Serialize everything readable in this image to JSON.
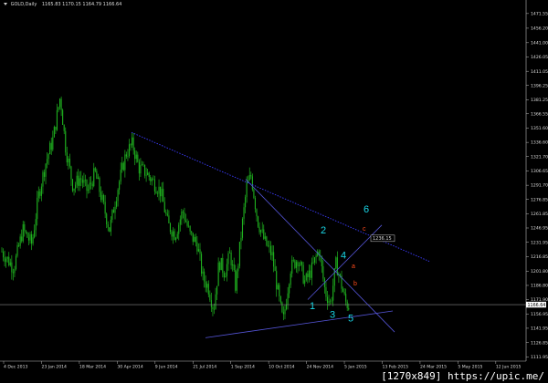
{
  "header": {
    "symbol": "GOLD,Daily",
    "ohlc": "1165.83 1170.15 1164.79 1166.64"
  },
  "watermark": "[1270x849] https://upic.me/",
  "colors": {
    "background": "#000000",
    "candles": "#1fb01f",
    "wave_labels": "#19d6e6",
    "sub_wave_labels": "#ff4a1a",
    "trendline_main": "#5555d8",
    "trendline_dotted": "#3c3cff",
    "price_marker": "#ffffff"
  },
  "chart_data": {
    "type": "candlestick",
    "title": "",
    "xlabel": "",
    "ylabel": "",
    "grid": false,
    "ylim": [
      1107.5,
      1480.0
    ],
    "y_ticks": [
      "1471.55",
      "1456.20",
      "1441.00",
      "1426.05",
      "1411.05",
      "1396.25",
      "1381.25",
      "1366.55",
      "1351.60",
      "1336.60",
      "1321.70",
      "1306.65",
      "1291.70",
      "1276.85",
      "1261.85",
      "1246.95",
      "1231.95",
      "1216.85",
      "1201.80",
      "1186.80",
      "1171.90",
      "1156.95",
      "1141.95",
      "1126.85",
      "1111.95"
    ],
    "x_ticks": [
      "4 Dec 2013",
      "23 Jan 2014",
      "18 Mar 2014",
      "30 Apr 2014",
      "9 Jun 2014",
      "21 Jul 2014",
      "1 Sep 2014",
      "10 Oct 2014",
      "24 Nov 2014",
      "5 Jan 2015",
      "13 Feb 2015",
      "24 Mar 2015",
      "5 May 2015",
      "12 Jun 2015"
    ],
    "current_price": "1166.64",
    "price_box": "1236.15",
    "price_path": [
      [
        0,
        1225
      ],
      [
        15,
        1205
      ],
      [
        25,
        1245
      ],
      [
        35,
        1230
      ],
      [
        42,
        1280
      ],
      [
        50,
        1315
      ],
      [
        58,
        1340
      ],
      [
        66,
        1385
      ],
      [
        72,
        1330
      ],
      [
        80,
        1290
      ],
      [
        88,
        1300
      ],
      [
        96,
        1285
      ],
      [
        104,
        1305
      ],
      [
        112,
        1275
      ],
      [
        120,
        1245
      ],
      [
        128,
        1285
      ],
      [
        138,
        1325
      ],
      [
        145,
        1335
      ],
      [
        152,
        1310
      ],
      [
        160,
        1305
      ],
      [
        168,
        1295
      ],
      [
        176,
        1285
      ],
      [
        184,
        1250
      ],
      [
        192,
        1240
      ],
      [
        200,
        1265
      ],
      [
        208,
        1240
      ],
      [
        216,
        1230
      ],
      [
        222,
        1195
      ],
      [
        228,
        1185
      ],
      [
        234,
        1162
      ],
      [
        240,
        1212
      ],
      [
        246,
        1200
      ],
      [
        252,
        1220
      ],
      [
        258,
        1185
      ],
      [
        264,
        1240
      ],
      [
        270,
        1290
      ],
      [
        275,
        1302
      ],
      [
        282,
        1255
      ],
      [
        290,
        1232
      ],
      [
        298,
        1218
      ],
      [
        305,
        1175
      ],
      [
        310,
        1148
      ],
      [
        318,
        1205
      ],
      [
        326,
        1215
      ],
      [
        334,
        1190
      ],
      [
        342,
        1205
      ],
      [
        349,
        1225
      ],
      [
        356,
        1180
      ],
      [
        362,
        1168
      ],
      [
        368,
        1210
      ],
      [
        372,
        1195
      ],
      [
        378,
        1170
      ],
      [
        382,
        1165
      ]
    ],
    "trendlines": [
      {
        "kind": "solid",
        "p1": [
          269,
          1298
        ],
        "p2": [
          432,
          1138
        ]
      },
      {
        "kind": "solid",
        "p1": [
          225,
          1132
        ],
        "p2": [
          430,
          1160
        ]
      },
      {
        "kind": "dotted",
        "p1": [
          144,
          1347
        ],
        "p2": [
          470,
          1212
        ]
      },
      {
        "kind": "solid",
        "p1": [
          337,
          1172
        ],
        "p2": [
          418,
          1250
        ]
      }
    ],
    "annotations": [
      {
        "text": "1",
        "x": 339,
        "y": 1162,
        "class": "wave"
      },
      {
        "text": "2",
        "x": 351,
        "y": 1241,
        "class": "wave"
      },
      {
        "text": "3",
        "x": 361,
        "y": 1153,
        "class": "wave"
      },
      {
        "text": "4",
        "x": 373,
        "y": 1215,
        "class": "wave"
      },
      {
        "text": "5",
        "x": 381,
        "y": 1149,
        "class": "wave"
      },
      {
        "text": "6",
        "x": 398,
        "y": 1263,
        "class": "wave"
      },
      {
        "text": "a",
        "x": 385,
        "y": 1205,
        "class": "sub"
      },
      {
        "text": "b",
        "x": 387,
        "y": 1187,
        "class": "sub"
      },
      {
        "text": "c",
        "x": 397,
        "y": 1244,
        "class": "sub"
      }
    ]
  }
}
